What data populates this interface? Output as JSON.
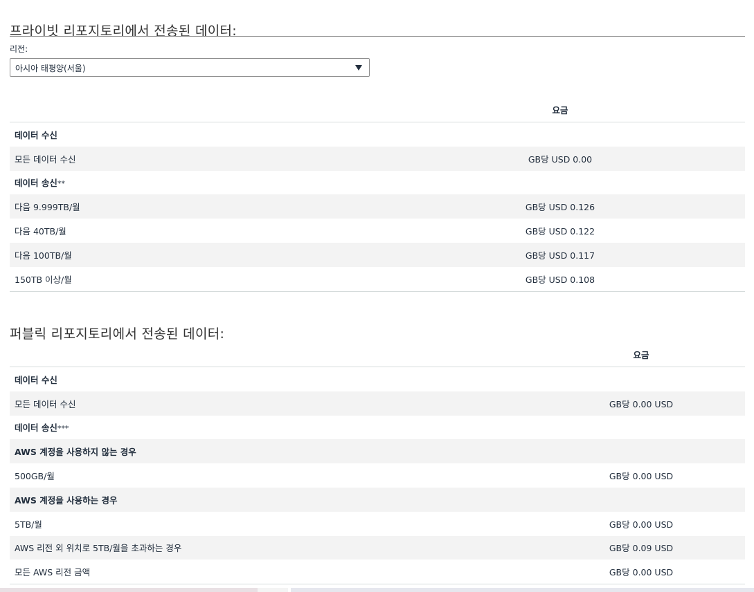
{
  "private_section": {
    "title": "프라이빗 리포지토리에서 전송된 데이터:",
    "region_label": "리전:",
    "region_value": "아시아 태평양(서울)",
    "price_header": "요금",
    "rows": [
      {
        "label": "데이터 수신",
        "price": "",
        "group": true,
        "alt": false,
        "sup": ""
      },
      {
        "label": "모든 데이터 수신",
        "price": "GB당 USD 0.00",
        "group": false,
        "alt": true,
        "sup": ""
      },
      {
        "label": "데이터 송신",
        "price": "",
        "group": true,
        "alt": false,
        "sup": "**"
      },
      {
        "label": "다음 9.999TB/월",
        "price": "GB당 USD 0.126",
        "group": false,
        "alt": true,
        "sup": ""
      },
      {
        "label": "다음 40TB/월",
        "price": "GB당 USD 0.122",
        "group": false,
        "alt": false,
        "sup": ""
      },
      {
        "label": "다음 100TB/월",
        "price": "GB당 USD 0.117",
        "group": false,
        "alt": true,
        "sup": ""
      },
      {
        "label": "150TB 이상/월",
        "price": "GB당 USD 0.108",
        "group": false,
        "alt": false,
        "sup": ""
      }
    ]
  },
  "public_section": {
    "title": "퍼블릭 리포지토리에서 전송된 데이터:",
    "price_header": "요금",
    "rows": [
      {
        "label": "데이터 수신",
        "price": "",
        "group": true,
        "alt": false,
        "sup": ""
      },
      {
        "label": "모든 데이터 수신",
        "price": "GB당 0.00 USD",
        "group": false,
        "alt": true,
        "sup": ""
      },
      {
        "label": "데이터 송신",
        "price": "",
        "group": true,
        "alt": false,
        "sup": "***"
      },
      {
        "label": "AWS 계정을 사용하지 않는 경우",
        "price": "",
        "group": true,
        "alt": true,
        "sup": ""
      },
      {
        "label": "500GB/월",
        "price": "GB당 0.00 USD",
        "group": false,
        "alt": false,
        "sup": ""
      },
      {
        "label": "AWS 계정을 사용하는 경우",
        "price": "",
        "group": true,
        "alt": true,
        "sup": ""
      },
      {
        "label": "5TB/월",
        "price": "GB당 0.00 USD",
        "group": false,
        "alt": false,
        "sup": ""
      },
      {
        "label": "AWS 리전 외 위치로 5TB/월을 초과하는 경우",
        "price": "GB당 0.09 USD",
        "group": false,
        "alt": true,
        "sup": ""
      },
      {
        "label": "모든 AWS 리전 금액",
        "price": "GB당 0.00 USD",
        "group": false,
        "alt": false,
        "sup": ""
      }
    ]
  }
}
